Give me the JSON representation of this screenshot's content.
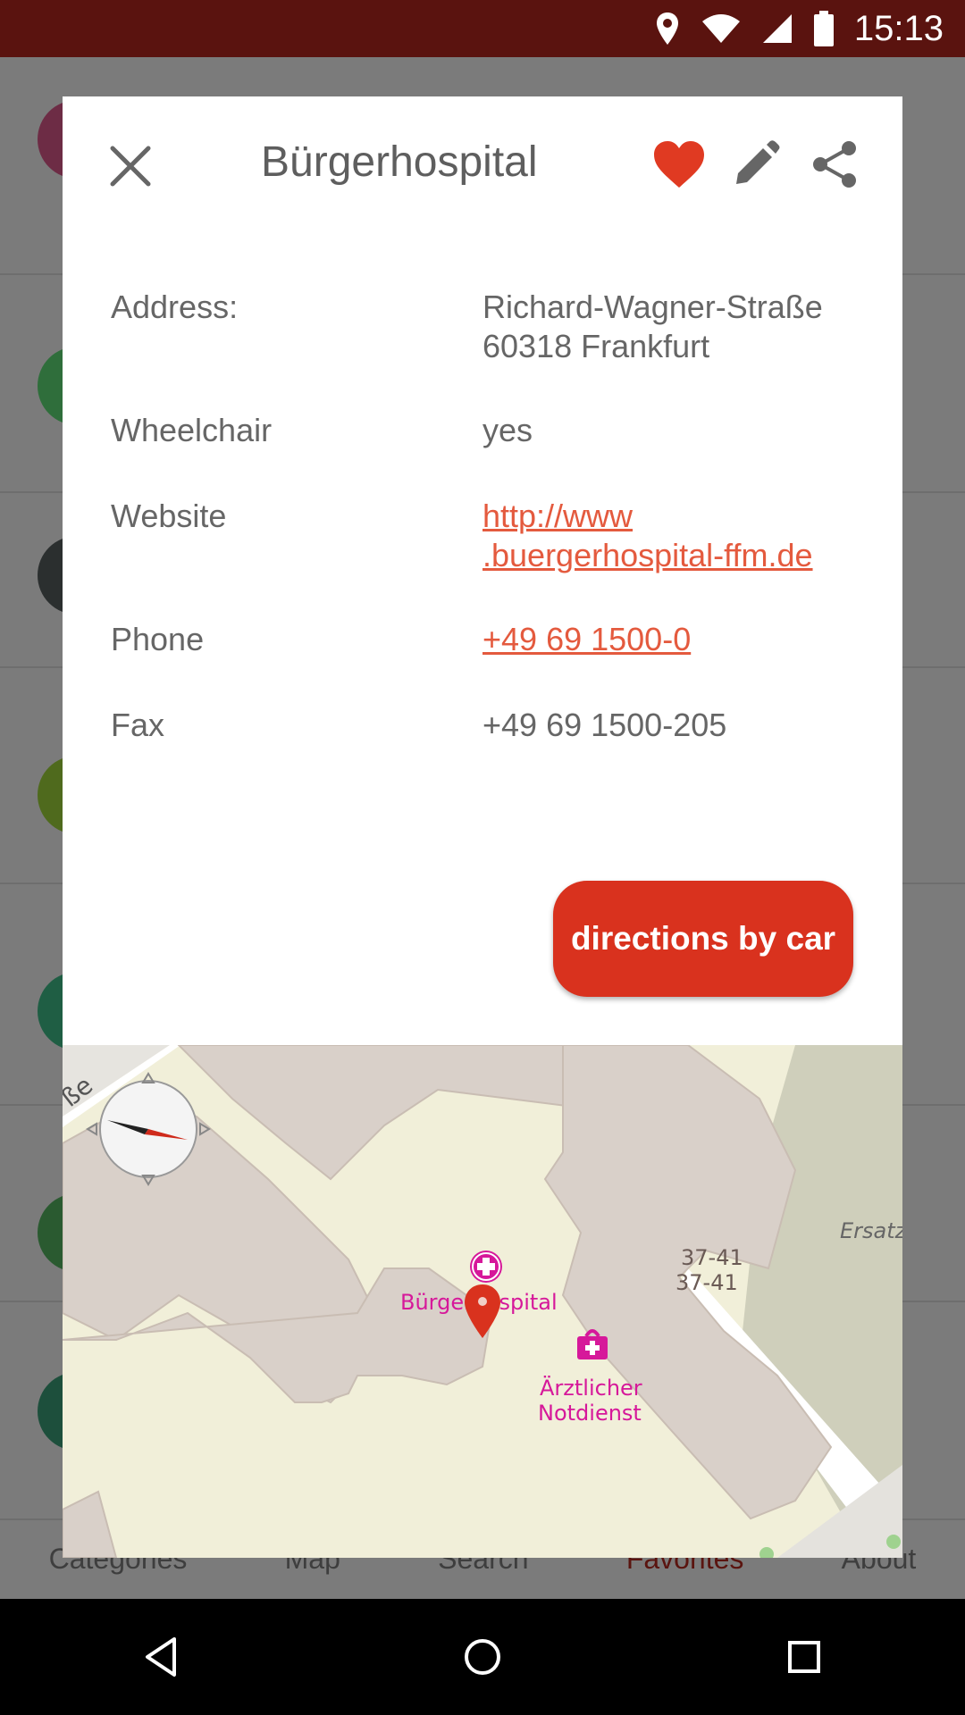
{
  "status": {
    "time": "15:13"
  },
  "background_nav": {
    "items": [
      "Categories",
      "Map",
      "Search",
      "Favorites",
      "About"
    ],
    "active": "Favorites"
  },
  "dialog": {
    "title": "Bürgerhospital",
    "details": [
      {
        "label": "Address:",
        "value": "Richard-Wagner-Straße\n60318 Frankfurt",
        "link": false
      },
      {
        "label": "Wheelchair",
        "value": "yes",
        "link": false
      },
      {
        "label": "Website",
        "value": "http://www\n.buergerhospital-ffm.de",
        "link": true
      },
      {
        "label": "Phone",
        "value": "+49 69 1500-0",
        "link": true
      },
      {
        "label": "Fax",
        "value": "+49 69 1500-205",
        "link": false
      }
    ],
    "directions_label": "directions by car"
  },
  "map": {
    "labels": {
      "poi_name": "Bürgerhospital",
      "poi2_line1": "Ärztlicher",
      "poi2_line2": "Notdienst",
      "house_no_1": "37-41",
      "house_no_2": "37-41",
      "street_fragment": "ße",
      "area_fragment": "Ersatz"
    }
  },
  "colors": {
    "statusbar": "#5a130f",
    "accent": "#d9321e",
    "link": "#e45a3e",
    "heart": "#e03a22",
    "poi_magenta": "#d6189a"
  }
}
